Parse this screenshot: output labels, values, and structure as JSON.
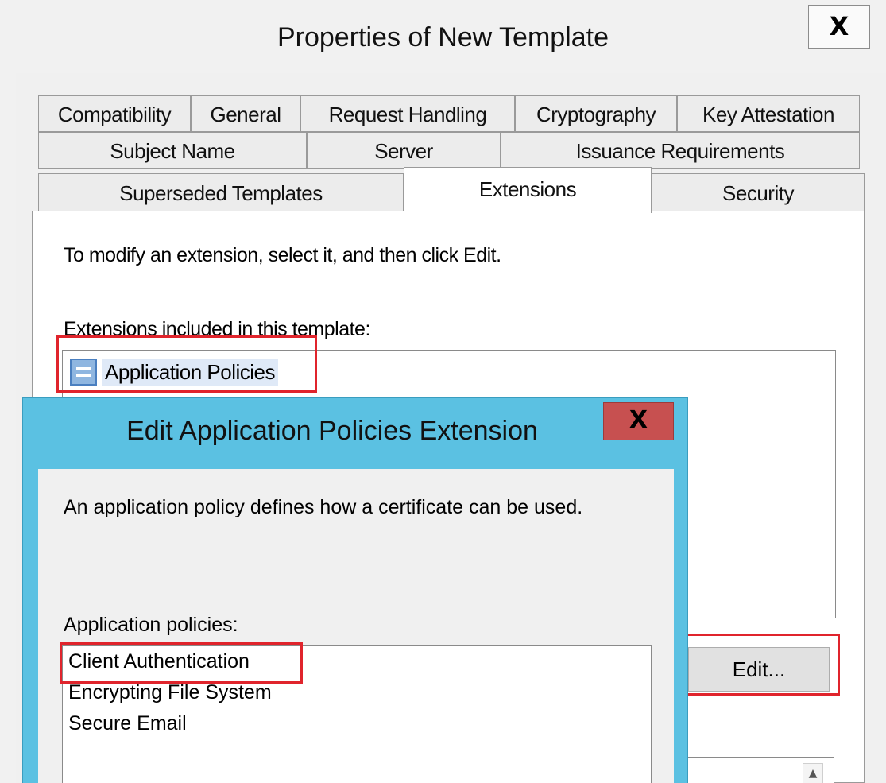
{
  "outer_dialog": {
    "title": "Properties of New Template",
    "close_label": "X",
    "tabs_row1": [
      "Compatibility",
      "General",
      "Request Handling",
      "Cryptography",
      "Key Attestation"
    ],
    "tabs_row2": [
      "Subject Name",
      "Server",
      "Issuance Requirements"
    ],
    "tabs_row3": [
      "Superseded Templates",
      "Extensions",
      "Security"
    ],
    "active_tab": "Extensions",
    "instruction": "To modify an extension, select it, and then click Edit.",
    "extensions_label": "Extensions included in this template:",
    "extensions": [
      "Application Policies"
    ],
    "edit_button_label": "Edit..."
  },
  "inner_dialog": {
    "title": "Edit Application Policies Extension",
    "close_label": "X",
    "description": "An application policy defines how a certificate can be used.",
    "policies_label": "Application policies:",
    "policies": [
      "Client Authentication",
      "Encrypting File System",
      "Secure Email"
    ]
  },
  "colors": {
    "inner_frame": "#5bc1e2",
    "close_button": "#c75050",
    "highlight": "#e0242c"
  }
}
